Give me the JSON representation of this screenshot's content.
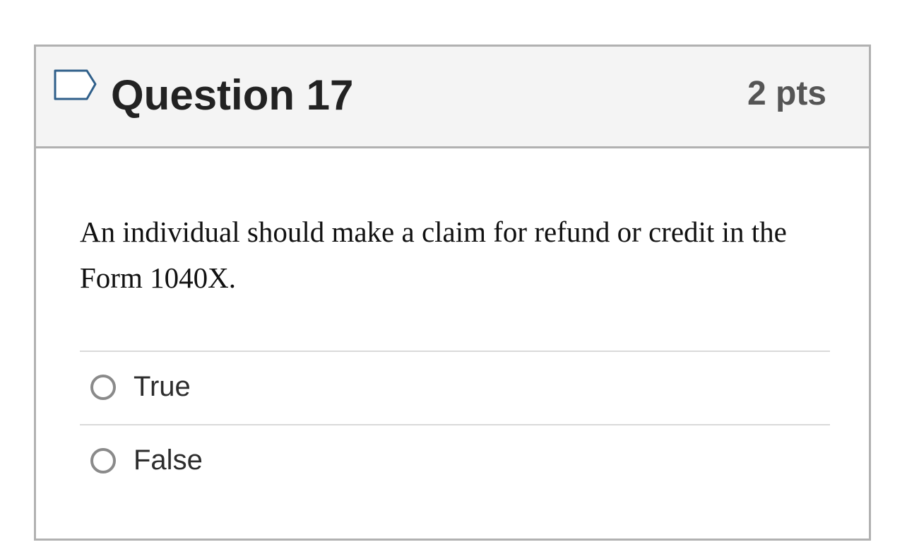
{
  "question": {
    "title": "Question 17",
    "points": "2 pts",
    "text": "An individual should make a claim for refund or credit in the Form 1040X.",
    "flag_icon": "flag-question-icon"
  },
  "answers": [
    {
      "label": "True",
      "selected": false
    },
    {
      "label": "False",
      "selected": false
    }
  ],
  "colors": {
    "header_background": "#f4f4f4",
    "border": "#b1b1b1",
    "flag_outline": "#2f5f8a",
    "radio_border": "#8a8a8a"
  }
}
